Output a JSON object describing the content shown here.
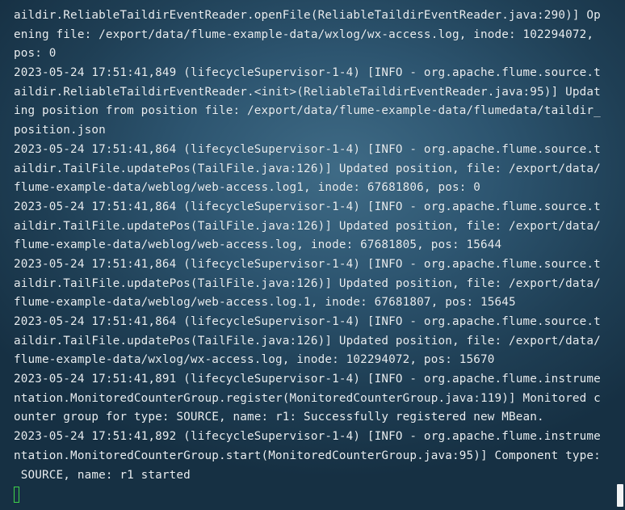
{
  "terminal": {
    "lines": [
      "aildir.ReliableTaildirEventReader.openFile(ReliableTaildirEventReader.java:290)] Op",
      "ening file: /export/data/flume-example-data/wxlog/wx-access.log, inode: 102294072,",
      "pos: 0",
      "2023-05-24 17:51:41,849 (lifecycleSupervisor-1-4) [INFO - org.apache.flume.source.t",
      "aildir.ReliableTaildirEventReader.<init>(ReliableTaildirEventReader.java:95)] Updat",
      "ing position from position file: /export/data/flume-example-data/flumedata/taildir_",
      "position.json",
      "2023-05-24 17:51:41,864 (lifecycleSupervisor-1-4) [INFO - org.apache.flume.source.t",
      "aildir.TailFile.updatePos(TailFile.java:126)] Updated position, file: /export/data/",
      "flume-example-data/weblog/web-access.log1, inode: 67681806, pos: 0",
      "2023-05-24 17:51:41,864 (lifecycleSupervisor-1-4) [INFO - org.apache.flume.source.t",
      "aildir.TailFile.updatePos(TailFile.java:126)] Updated position, file: /export/data/",
      "flume-example-data/weblog/web-access.log, inode: 67681805, pos: 15644",
      "2023-05-24 17:51:41,864 (lifecycleSupervisor-1-4) [INFO - org.apache.flume.source.t",
      "aildir.TailFile.updatePos(TailFile.java:126)] Updated position, file: /export/data/",
      "flume-example-data/weblog/web-access.log.1, inode: 67681807, pos: 15645",
      "2023-05-24 17:51:41,864 (lifecycleSupervisor-1-4) [INFO - org.apache.flume.source.t",
      "aildir.TailFile.updatePos(TailFile.java:126)] Updated position, file: /export/data/",
      "flume-example-data/wxlog/wx-access.log, inode: 102294072, pos: 15670",
      "2023-05-24 17:51:41,891 (lifecycleSupervisor-1-4) [INFO - org.apache.flume.instrume",
      "ntation.MonitoredCounterGroup.register(MonitoredCounterGroup.java:119)] Monitored c",
      "ounter group for type: SOURCE, name: r1: Successfully registered new MBean.",
      "2023-05-24 17:51:41,892 (lifecycleSupervisor-1-4) [INFO - org.apache.flume.instrume",
      "ntation.MonitoredCounterGroup.start(MonitoredCounterGroup.java:95)] Component type:",
      " SOURCE, name: r1 started"
    ]
  },
  "colors": {
    "text": "#e8eef2",
    "cursor": "#3fd14a",
    "scroll_thumb": "#f2f4f5"
  }
}
